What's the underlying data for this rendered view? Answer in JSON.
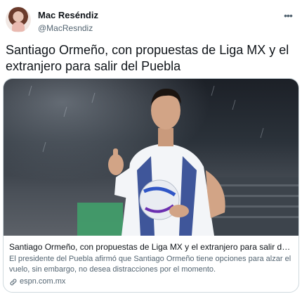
{
  "author": {
    "name": "Mac Reséndiz",
    "handle": "@MacResndiz"
  },
  "tweet": {
    "text": "Santiago Ormeño, con propuestas de Liga MX y el extranjero para salir del Puebla"
  },
  "card": {
    "title": "Santiago Ormeño, con propuestas de Liga MX y el extranjero para salir del Pue...",
    "description": "El presidente del Puebla afirmó que Santiago Ormeño tiene opciones para alzar el vuelo, sin embargo, no desea distracciones por el momento.",
    "domain": "espn.com.mx"
  },
  "icons": {
    "more": "more-options-icon",
    "link": "link-icon"
  },
  "colors": {
    "text_primary": "#0f1419",
    "text_secondary": "#536471",
    "border": "#cfd9de"
  }
}
